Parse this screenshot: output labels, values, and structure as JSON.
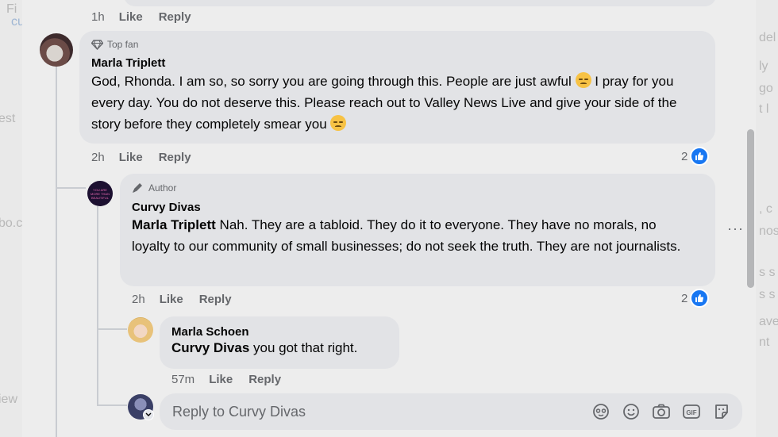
{
  "comments": [
    {
      "meta": {
        "time": "1h",
        "like": "Like",
        "reply": "Reply"
      }
    },
    {
      "badge": "Top fan",
      "author": "Marla Triplett",
      "text_1": "God, Rhonda. I am so, so sorry you are going through this. People are just awful",
      "text_2": "I pray for you every day. You do not deserve this. Please reach out to Valley News Live and give your side of the story before they completely smear you",
      "meta": {
        "time": "2h",
        "like": "Like",
        "reply": "Reply"
      },
      "reaction_count": "2"
    },
    {
      "badge": "Author",
      "author": "Curvy Divas",
      "mention": "Marla Triplett",
      "text": "Nah. They are a tabloid. They do it to everyone. They have no morals, no loyalty to our community of small businesses; do not seek the truth. They are not journalists.",
      "meta": {
        "time": "2h",
        "like": "Like",
        "reply": "Reply"
      },
      "reaction_count": "2",
      "more": "···"
    },
    {
      "author": "Marla Schoen",
      "mention": "Curvy Divas",
      "text": "you got that right.",
      "meta": {
        "time": "57m",
        "like": "Like",
        "reply": "Reply"
      }
    }
  ],
  "reply_box": {
    "placeholder": "Reply to Curvy Divas"
  },
  "icons": [
    "avatar-icon",
    "emoji-icon",
    "camera-icon",
    "gif-icon",
    "sticker-icon",
    "like-icon",
    "diamond-icon",
    "pencil-icon"
  ],
  "colors": {
    "like_blue": "#1877f2",
    "bubble": "#e2e3e6",
    "meta_gray": "#65676b"
  }
}
